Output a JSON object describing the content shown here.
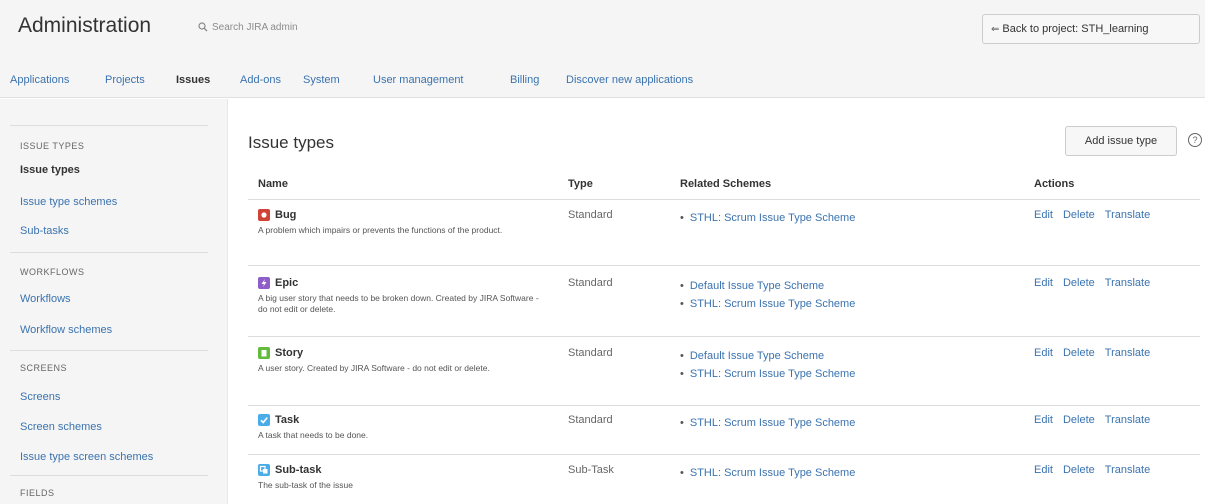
{
  "header": {
    "title": "Administration",
    "search_placeholder": "Search JIRA admin",
    "back_label": "Back to project: STH_learning"
  },
  "nav": {
    "tabs": [
      {
        "label": "Applications"
      },
      {
        "label": "Projects"
      },
      {
        "label": "Issues",
        "active": true
      },
      {
        "label": "Add-ons"
      },
      {
        "label": "System"
      },
      {
        "label": "User management"
      },
      {
        "label": "Billing"
      },
      {
        "label": "Discover new applications"
      }
    ]
  },
  "sidebar": {
    "sections": [
      {
        "heading": "ISSUE TYPES",
        "items": [
          "Issue types",
          "Issue type schemes",
          "Sub-tasks"
        ]
      },
      {
        "heading": "WORKFLOWS",
        "items": [
          "Workflows",
          "Workflow schemes"
        ]
      },
      {
        "heading": "SCREENS",
        "items": [
          "Screens",
          "Screen schemes",
          "Issue type screen schemes"
        ]
      },
      {
        "heading": "FIELDS",
        "items": []
      }
    ]
  },
  "main": {
    "title": "Issue types",
    "add_button": "Add issue type",
    "help_icon": "?",
    "columns": [
      "Name",
      "Type",
      "Related Schemes",
      "Actions"
    ],
    "actions": [
      "Edit",
      "Delete",
      "Translate"
    ],
    "rows": [
      {
        "icon": "bug-icon",
        "color": "#d04437",
        "name": "Bug",
        "description": "A problem which impairs or prevents the functions of the product.",
        "type": "Standard",
        "schemes": [
          "STHL: Scrum Issue Type Scheme"
        ]
      },
      {
        "icon": "epic-icon",
        "color": "#8f5dc8",
        "name": "Epic",
        "description": "A big user story that needs to be broken down. Created by JIRA Software - do not edit or delete.",
        "type": "Standard",
        "schemes": [
          "Default Issue Type Scheme",
          "STHL: Scrum Issue Type Scheme"
        ]
      },
      {
        "icon": "story-icon",
        "color": "#63ba3c",
        "name": "Story",
        "description": "A user story. Created by JIRA Software - do not edit or delete.",
        "type": "Standard",
        "schemes": [
          "Default Issue Type Scheme",
          "STHL: Scrum Issue Type Scheme"
        ]
      },
      {
        "icon": "task-icon",
        "color": "#4bade8",
        "name": "Task",
        "description": "A task that needs to be done.",
        "type": "Standard",
        "schemes": [
          "STHL: Scrum Issue Type Scheme"
        ]
      },
      {
        "icon": "subtask-icon",
        "color": "#4bade8",
        "name": "Sub-task",
        "description": "The sub-task of the issue",
        "type": "Sub-Task",
        "schemes": [
          "STHL: Scrum Issue Type Scheme"
        ]
      }
    ]
  }
}
